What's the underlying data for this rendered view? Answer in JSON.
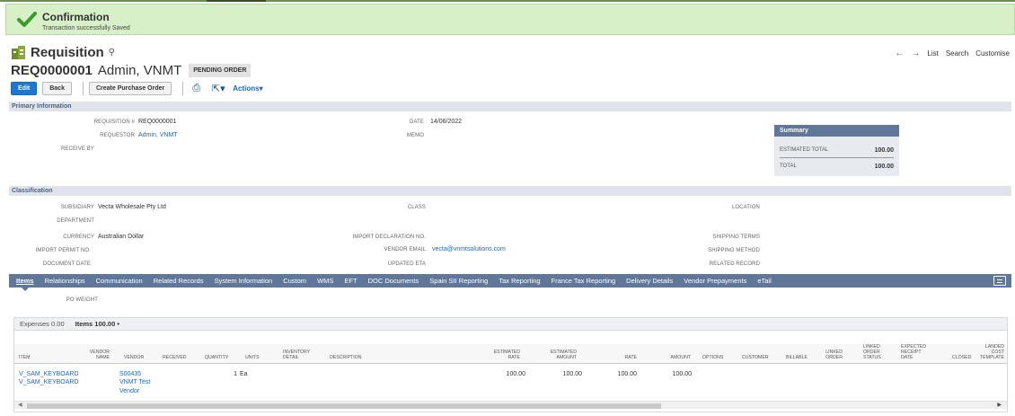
{
  "confirmation": {
    "title": "Confirmation",
    "message": "Transaction successfully Saved"
  },
  "header": {
    "record_type": "Requisition",
    "record_number": "REQ0000001",
    "record_name": "Admin, VNMT",
    "status": "PENDING ORDER",
    "nav_links": [
      "List",
      "Search",
      "Customise"
    ]
  },
  "buttons": {
    "edit": "Edit",
    "back": "Back",
    "create_po": "Create Purchase Order",
    "actions": "Actions"
  },
  "primary": {
    "section_title": "Primary Information",
    "requisition_no_label": "REQUISITION #",
    "requisition_no": "REQ0000001",
    "requestor_label": "REQUESTOR",
    "requestor": "Admin, VNMT",
    "receive_by_label": "RECEIVE BY",
    "date_label": "DATE",
    "date": "14/06/2022",
    "memo_label": "MEMO"
  },
  "summary": {
    "title": "Summary",
    "estimated_total_label": "ESTIMATED TOTAL",
    "estimated_total": "100.00",
    "total_label": "TOTAL",
    "total": "100.00"
  },
  "classification": {
    "section_title": "Classification",
    "subsidiary_label": "SUBSIDIARY",
    "subsidiary": "Vecta Wholesale Pty Ltd",
    "department_label": "DEPARTMENT",
    "currency_label": "CURRENCY",
    "currency": "Australian Dollar",
    "import_permit_label": "IMPORT PERMIT NO.",
    "document_date_label": "DOCUMENT DATE",
    "class_label": "CLASS",
    "import_declaration_label": "IMPORT DECLARATION NO.",
    "vendor_email_label": "VENDOR EMAIL",
    "vendor_email": "vecta@vnmtsolutions.com",
    "updated_eta_label": "UPDATED ETA",
    "location_label": "LOCATION",
    "shipping_terms_label": "SHIPPING TERMS",
    "shipping_method_label": "SHIPPING METHOD",
    "related_record_label": "RELATED RECORD"
  },
  "tabs": [
    "Items",
    "Relationships",
    "Communication",
    "Related Records",
    "System Information",
    "Custom",
    "WMS",
    "EFT",
    "DOC Documents",
    "Spain SII Reporting",
    "Tax Reporting",
    "France Tax Reporting",
    "Delivery Details",
    "Vendor Prepayments",
    "eTail"
  ],
  "po_weight_label": "PO WEIGHT",
  "subtabs": {
    "expenses": "Expenses 0.00",
    "items": "Items 100.00",
    "items_marker": "•"
  },
  "grid": {
    "headers": [
      "ITEM",
      "VENDOR NAME",
      "VENDOR",
      "RECEIVED",
      "QUANTITY",
      "UNITS",
      "INVENTORY DETAIL",
      "DESCRIPTION",
      "ESTIMATED RATE",
      "ESTIMATED AMOUNT",
      "RATE",
      "AMOUNT",
      "OPTIONS",
      "CUSTOMER",
      "BILLABLE",
      "LINKED ORDER",
      "LINKED ORDER STATUS",
      "EXPECTED RECEIPT DATE",
      "CLOSED",
      "LANDED COST TEMPLATE"
    ],
    "row": {
      "item_1": "V_SAM_KEYBOARD",
      "item_2": "V_SAM_KEYBOARD",
      "vendor_1": "S00435",
      "vendor_2": "VNMT Test",
      "vendor_3": "Vendor",
      "quantity": "1",
      "units": "Ea",
      "estimated_rate": "100.00",
      "estimated_amount": "100.00",
      "rate": "100.00",
      "amount": "100.00"
    }
  },
  "colors": {
    "success_bg": "#d8f0c8",
    "accent_blue": "#1e78d0",
    "tab_bar": "#607799",
    "section_bg": "#dfe4eb"
  },
  "icons": [
    "checkmark-icon",
    "requisition-icon",
    "search-icon",
    "arrow-left-icon",
    "arrow-right-icon",
    "print-icon",
    "export-icon",
    "grid-menu-icon"
  ]
}
